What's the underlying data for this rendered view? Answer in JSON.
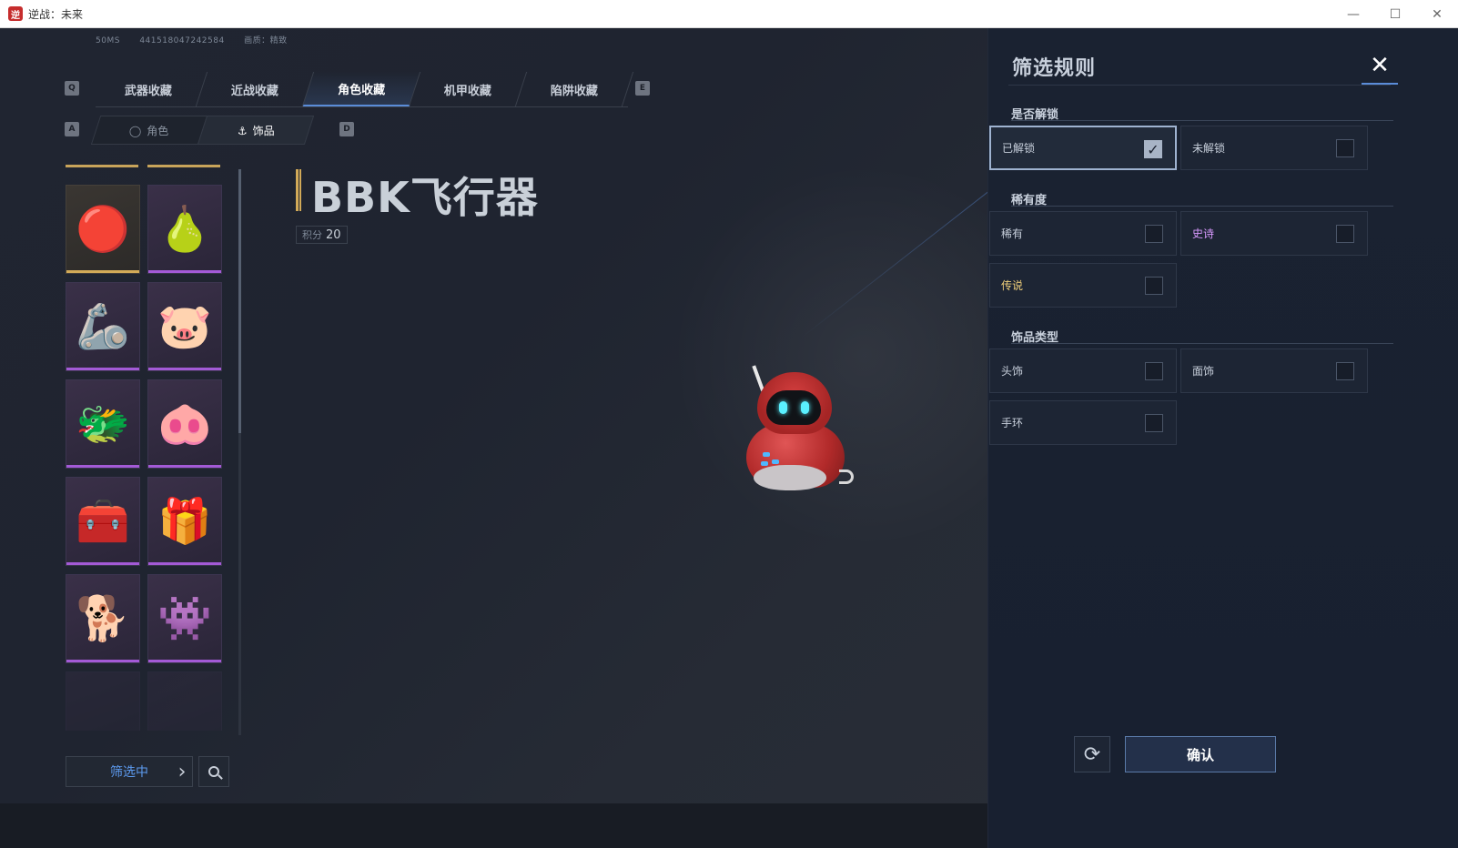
{
  "window": {
    "title": "逆战：未来",
    "controls": {
      "minimize": "—",
      "maximize": "☐",
      "close": "✕"
    }
  },
  "info_strip": {
    "ping": "50MS",
    "id": "441518047242584",
    "quality": "画质：精致"
  },
  "key_hints": {
    "prev_tab": "Q",
    "next_tab": "E",
    "prev_sub": "A",
    "next_sub": "D"
  },
  "main_tabs": [
    {
      "label": "武器收藏",
      "active": false
    },
    {
      "label": "近战收藏",
      "active": false
    },
    {
      "label": "角色收藏",
      "active": true
    },
    {
      "label": "机甲收藏",
      "active": false
    },
    {
      "label": "陷阱收藏",
      "active": false
    }
  ],
  "sub_tabs": [
    {
      "label": "角色",
      "icon": "character-icon",
      "active": false
    },
    {
      "label": "饰品",
      "icon": "accessory-icon",
      "active": true
    }
  ],
  "items": [
    {
      "name": "sensor-orb",
      "glyph": "🔴",
      "rarity": "gold"
    },
    {
      "name": "crying-pear",
      "glyph": "🍐",
      "rarity": "purple"
    },
    {
      "name": "mech-wings",
      "glyph": "🦾",
      "rarity": "purple"
    },
    {
      "name": "pig-helmet",
      "glyph": "🐷",
      "rarity": "purple"
    },
    {
      "name": "green-dragon",
      "glyph": "🐲",
      "rarity": "purple"
    },
    {
      "name": "pig-warrior",
      "glyph": "🐽",
      "rarity": "purple"
    },
    {
      "name": "treasure-chest",
      "glyph": "🧰",
      "rarity": "purple"
    },
    {
      "name": "angry-gift",
      "glyph": "🎁",
      "rarity": "purple"
    },
    {
      "name": "shiba",
      "glyph": "🐕",
      "rarity": "purple"
    },
    {
      "name": "blue-spider",
      "glyph": "👾",
      "rarity": "purple"
    }
  ],
  "filter_footer": {
    "filter_label": "筛选中"
  },
  "detail": {
    "title": "BBK飞行器",
    "score_label": "积分",
    "score_value": "20"
  },
  "filter_panel": {
    "title": "筛选规则",
    "sections": {
      "unlock": {
        "label": "是否解锁",
        "options": [
          {
            "label": "已解锁",
            "checked": true
          },
          {
            "label": "未解锁",
            "checked": false
          }
        ]
      },
      "rarity": {
        "label": "稀有度",
        "options": [
          {
            "label": "稀有",
            "checked": false,
            "color": "#c8d0dc"
          },
          {
            "label": "史诗",
            "checked": false,
            "color": "#d99aff"
          },
          {
            "label": "传说",
            "checked": false,
            "color": "#f0cf7a"
          }
        ]
      },
      "type": {
        "label": "饰品类型",
        "options": [
          {
            "label": "头饰",
            "checked": false
          },
          {
            "label": "面饰",
            "checked": false
          },
          {
            "label": "手环",
            "checked": false
          }
        ]
      }
    },
    "confirm_label": "确认",
    "reset_icon": "refresh-icon"
  }
}
